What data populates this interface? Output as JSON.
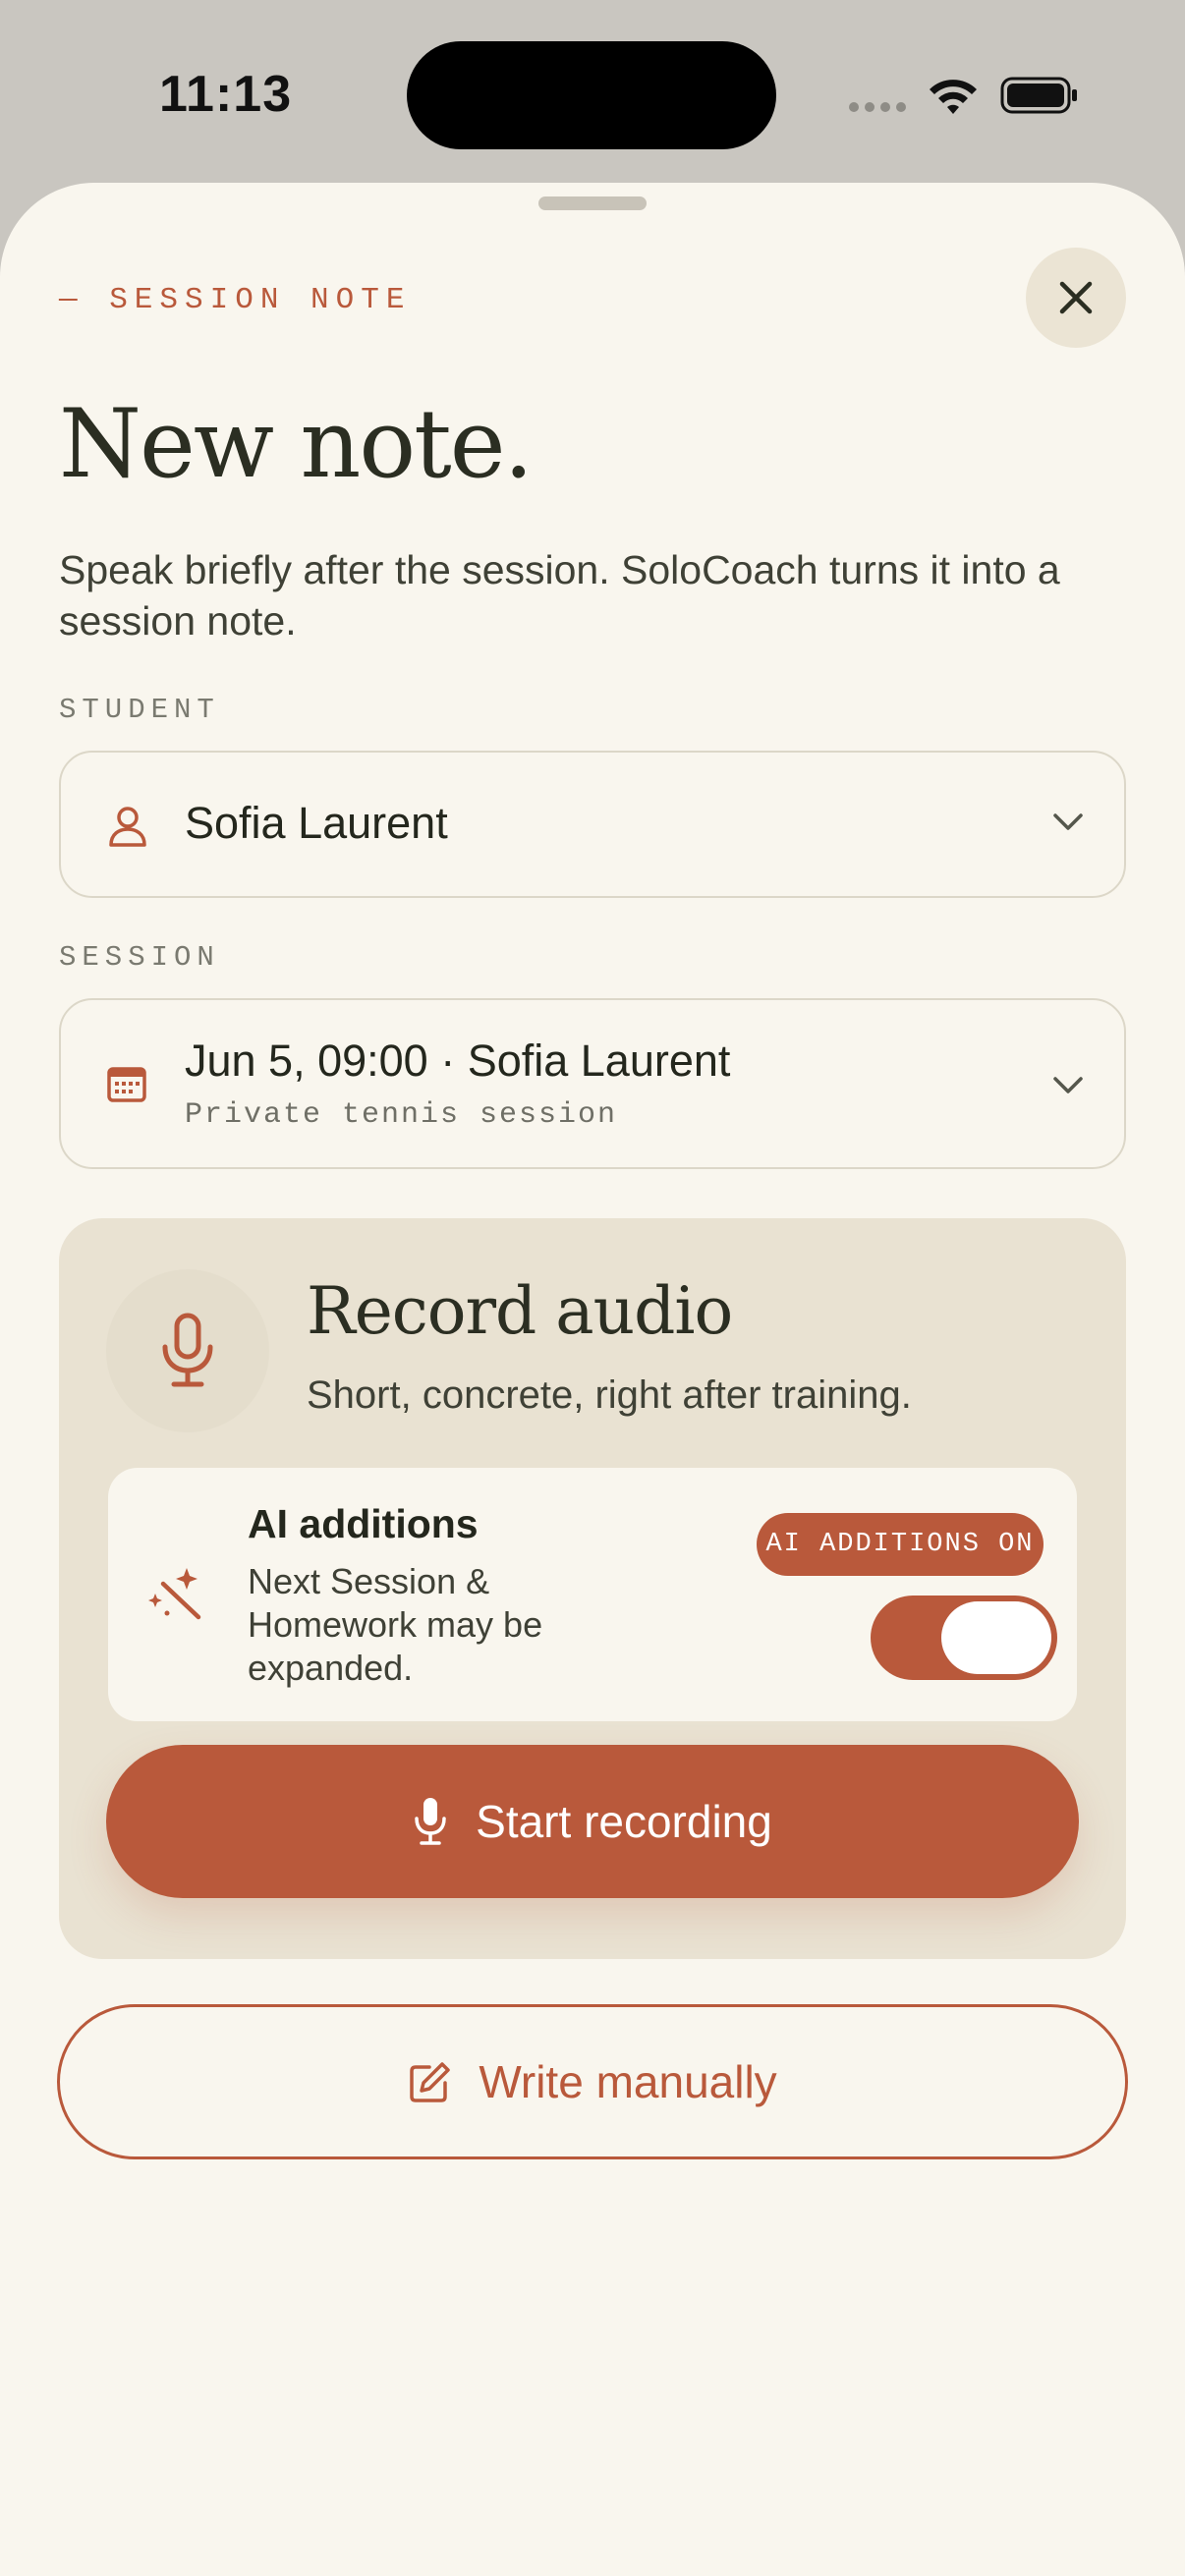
{
  "status_bar": {
    "time": "11:13"
  },
  "sheet": {
    "eyebrow": "— SESSION NOTE",
    "title": "New note.",
    "subtitle": "Speak briefly after the session. SoloCoach turns it into a session note."
  },
  "student": {
    "label": "STUDENT",
    "value": "Sofia Laurent",
    "icon": "person-icon"
  },
  "session": {
    "label": "SESSION",
    "value": "Jun 5, 09:00 · Sofia Laurent",
    "detail": "Private tennis session",
    "icon": "calendar-icon"
  },
  "record": {
    "title": "Record audio",
    "subtitle": "Short, concrete, right after training.",
    "ai": {
      "title": "AI additions",
      "description": "Next Session & Homework may be expanded.",
      "badge": "AI ADDITIONS ON",
      "enabled": true
    },
    "start_label": "Start recording"
  },
  "write_manually_label": "Write manually",
  "colors": {
    "accent": "#b9593b",
    "sheet": "#f9f6ee",
    "card": "#e9e2d2",
    "ink": "#2c2f24"
  }
}
